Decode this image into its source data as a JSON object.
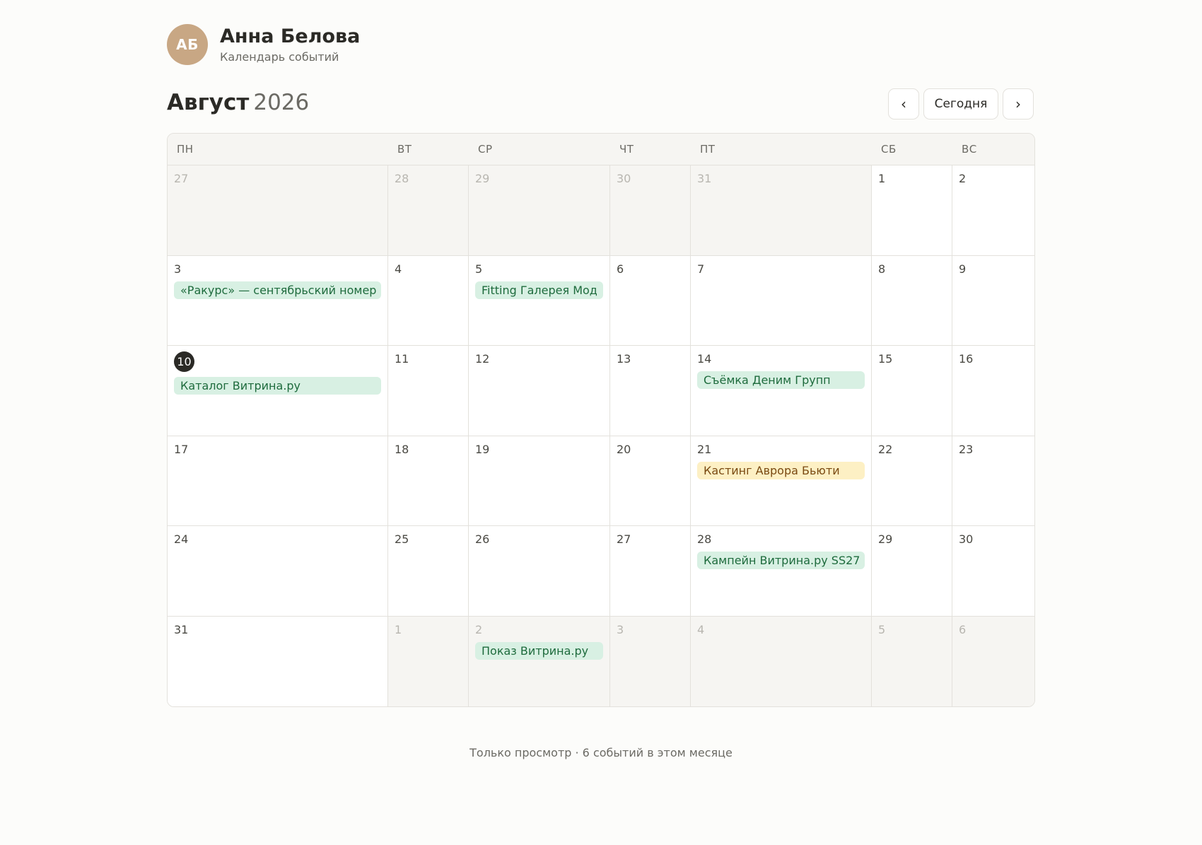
{
  "profile": {
    "initials": "АБ",
    "name": "Анна Белова",
    "subtitle": "Календарь событий"
  },
  "header": {
    "month": "Август",
    "year": "2026"
  },
  "nav": {
    "prev_glyph": "‹",
    "today_label": "Сегодня",
    "next_glyph": "›"
  },
  "weekdays": [
    "ПН",
    "ВТ",
    "СР",
    "ЧТ",
    "ПТ",
    "СБ",
    "ВС"
  ],
  "weeks": [
    [
      {
        "day": "27",
        "out": true
      },
      {
        "day": "28",
        "out": true
      },
      {
        "day": "29",
        "out": true
      },
      {
        "day": "30",
        "out": true
      },
      {
        "day": "31",
        "out": true
      },
      {
        "day": "1"
      },
      {
        "day": "2"
      }
    ],
    [
      {
        "day": "3",
        "event": {
          "label": "«Ракурс» — сентябрьский номер",
          "color": "green"
        }
      },
      {
        "day": "4"
      },
      {
        "day": "5",
        "event": {
          "label": "Fitting Галерея Мод",
          "color": "green"
        }
      },
      {
        "day": "6"
      },
      {
        "day": "7"
      },
      {
        "day": "8"
      },
      {
        "day": "9"
      }
    ],
    [
      {
        "day": "10",
        "today": true,
        "event": {
          "label": "Каталог Витрина.ру",
          "color": "green"
        }
      },
      {
        "day": "11"
      },
      {
        "day": "12"
      },
      {
        "day": "13"
      },
      {
        "day": "14",
        "event": {
          "label": "Съёмка Деним Групп",
          "color": "green"
        }
      },
      {
        "day": "15"
      },
      {
        "day": "16"
      }
    ],
    [
      {
        "day": "17"
      },
      {
        "day": "18"
      },
      {
        "day": "19"
      },
      {
        "day": "20"
      },
      {
        "day": "21",
        "event": {
          "label": "Кастинг Аврора Бьюти",
          "color": "yellow"
        }
      },
      {
        "day": "22"
      },
      {
        "day": "23"
      }
    ],
    [
      {
        "day": "24"
      },
      {
        "day": "25"
      },
      {
        "day": "26"
      },
      {
        "day": "27"
      },
      {
        "day": "28",
        "event": {
          "label": "Кампейн Витрина.ру SS27",
          "color": "green"
        }
      },
      {
        "day": "29"
      },
      {
        "day": "30"
      }
    ],
    [
      {
        "day": "31"
      },
      {
        "day": "1",
        "out": true
      },
      {
        "day": "2",
        "out": true,
        "event": {
          "label": "Показ Витрина.ру",
          "color": "green"
        }
      },
      {
        "day": "3",
        "out": true
      },
      {
        "day": "4",
        "out": true
      },
      {
        "day": "5",
        "out": true
      },
      {
        "day": "6",
        "out": true
      }
    ]
  ],
  "footer": {
    "text": "Только просмотр · 6 событий в этом месяце"
  },
  "colors": {
    "event_green_bg": "#d8f0e3",
    "event_green_text": "#1e6b3d",
    "event_yellow_bg": "#fdf0c4",
    "event_yellow_text": "#7a4a12",
    "today_badge": "#2b2a26",
    "avatar": "#c8a784"
  }
}
